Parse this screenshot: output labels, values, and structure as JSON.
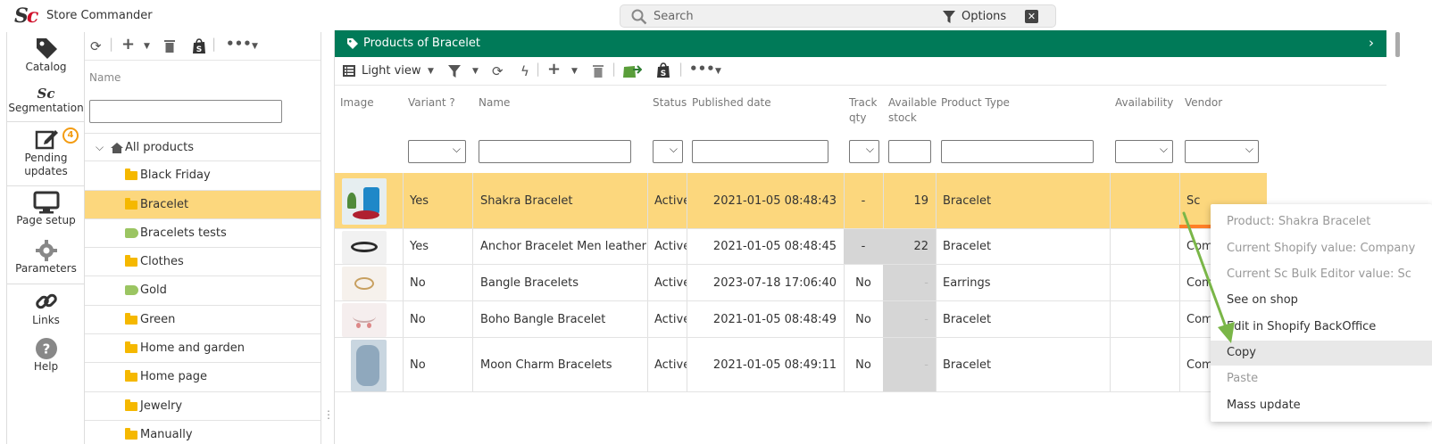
{
  "app": {
    "logo_s": "S",
    "logo_c": "c",
    "title": "Store Commander"
  },
  "search": {
    "placeholder": "Search",
    "options_label": "Options",
    "close": "✕"
  },
  "nav": {
    "catalog": "Catalog",
    "segmentation_logo": "Sc",
    "segmentation": "Segmentation",
    "pending": "Pending updates",
    "pending_badge": "4",
    "page_setup": "Page setup",
    "parameters": "Parameters",
    "links": "Links",
    "help": "Help"
  },
  "tree": {
    "header": "Name",
    "root": "All products",
    "items": [
      {
        "label": "Black Friday",
        "kind": "folder"
      },
      {
        "label": "Bracelet",
        "kind": "folder",
        "selected": true
      },
      {
        "label": "Bracelets tests",
        "kind": "tag"
      },
      {
        "label": "Clothes",
        "kind": "folder"
      },
      {
        "label": "Gold",
        "kind": "tag"
      },
      {
        "label": "Green",
        "kind": "folder"
      },
      {
        "label": "Home and garden",
        "kind": "folder"
      },
      {
        "label": "Home page",
        "kind": "folder"
      },
      {
        "label": "Jewelry",
        "kind": "folder"
      },
      {
        "label": "Manually",
        "kind": "folder"
      }
    ]
  },
  "main": {
    "title": "Products of Bracelet",
    "view_label": "Light view",
    "columns": {
      "image": "Image",
      "variant": "Variant ?",
      "name": "Name",
      "status": "Status",
      "published": "Published date",
      "track1": "Track",
      "track2": "qty",
      "avail1": "Available",
      "avail2": "stock",
      "ptype": "Product Type",
      "availability": "Availability",
      "vendor": "Vendor"
    },
    "rows": [
      {
        "variant": "Yes",
        "name": "Shakra Bracelet",
        "status": "Active",
        "published": "2021-01-05 08:48:43",
        "track": "-",
        "stock": "19",
        "ptype": "Bracelet",
        "vendor": "Sc"
      },
      {
        "variant": "Yes",
        "name": "Anchor Bracelet Men leather",
        "status": "Active",
        "published": "2021-01-05 08:48:45",
        "track": "-",
        "stock": "22",
        "ptype": "Bracelet",
        "vendor": "Com"
      },
      {
        "variant": "No",
        "name": "Bangle Bracelets",
        "status": "Active",
        "published": "2023-07-18 17:06:40",
        "track": "No",
        "stock": "-",
        "ptype": "Earrings",
        "vendor": "Com"
      },
      {
        "variant": "No",
        "name": "Boho Bangle Bracelet",
        "status": "Active",
        "published": "2021-01-05 08:48:49",
        "track": "No",
        "stock": "-",
        "ptype": "Bracelet",
        "vendor": "Com"
      },
      {
        "variant": "No",
        "name": "Moon Charm Bracelets",
        "status": "Active",
        "published": "2021-01-05 08:49:11",
        "track": "No",
        "stock": "-",
        "ptype": "Bracelet",
        "vendor": "Com"
      }
    ]
  },
  "context_menu": {
    "product": "Product: Shakra Bracelet",
    "shopify_value": "Current Shopify value: Company",
    "sc_value": "Current Sc Bulk Editor value: Sc",
    "see_on_shop": "See on shop",
    "edit_backoffice": "Edit in Shopify BackOffice",
    "copy": "Copy",
    "paste": "Paste",
    "mass_update": "Mass update"
  },
  "colors": {
    "header_green": "#007a58",
    "selection": "#fcd77d",
    "brand_red": "#d0102a",
    "folder": "#f5b800",
    "tag": "#9bc562"
  }
}
